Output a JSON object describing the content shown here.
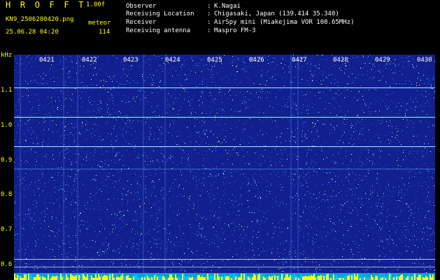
{
  "header": {
    "app_title": "H R O F F T",
    "version": "1.00f",
    "filename": "KN9_2506280420.png",
    "meteor_label": "meteor",
    "datetime": "25.06.28 04:20",
    "meteor_count": "114"
  },
  "metadata": [
    {
      "key": "Observer",
      "value": "K.Nagai"
    },
    {
      "key": "Receiving Location",
      "value": "Chigasaki, Japan (139.414 35.340)"
    },
    {
      "key": "Receiver",
      "value": "AirSpy mini (Miakejima VOR 108.65MHz)"
    },
    {
      "key": "Receiving antenna",
      "value": "Maspro FM-3"
    }
  ],
  "spectrogram": {
    "unit_label": "kHz",
    "y_ticks": [
      "1.1",
      "1.0",
      "0.9",
      "0.8",
      "0.7",
      "0.6"
    ],
    "x_ticks": [
      "0421",
      "0422",
      "0423",
      "0424",
      "0425",
      "0426",
      "0427",
      "0428",
      "0429",
      "0430"
    ],
    "background_color": "#11208e",
    "tick_color": "#ffff00"
  }
}
